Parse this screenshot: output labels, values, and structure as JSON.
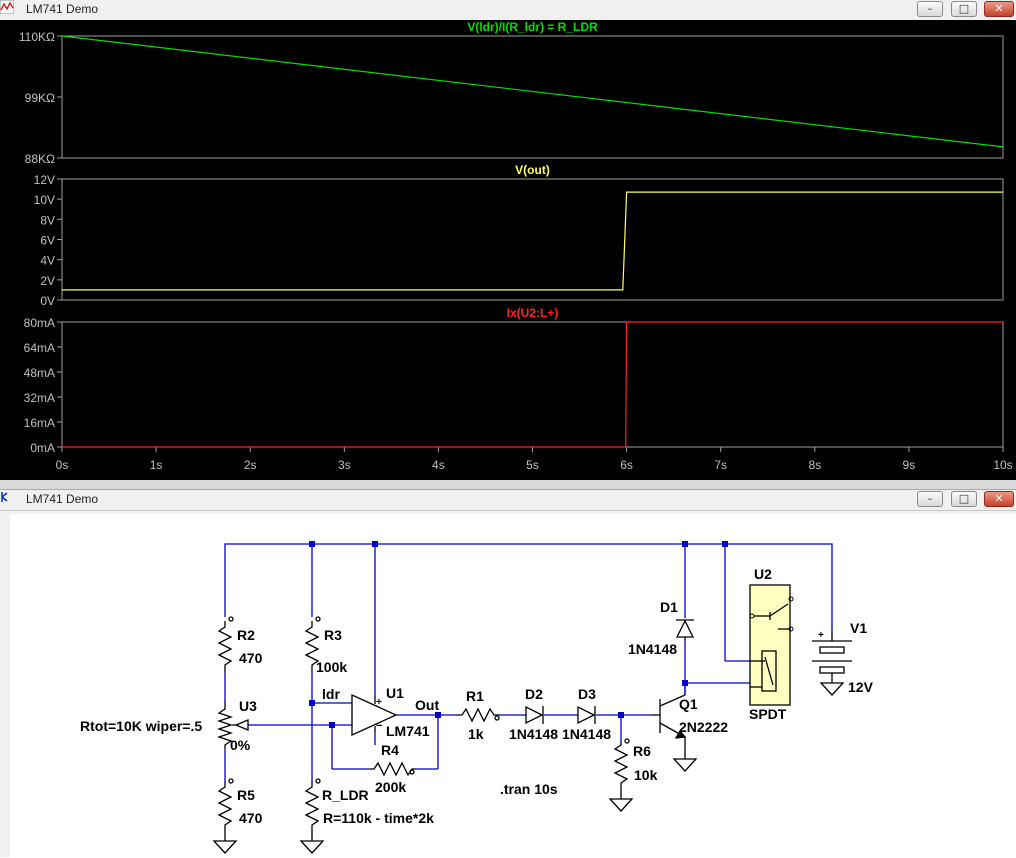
{
  "plot_window": {
    "title": "LM741 Demo",
    "buttons": {
      "minimize": "–",
      "maximize": "□",
      "close": "✕"
    }
  },
  "schematic_window": {
    "title": "LM741 Demo",
    "buttons": {
      "minimize": "–",
      "maximize": "□",
      "close": "✕"
    }
  },
  "colors": {
    "trace_rldr": "#00e000",
    "trace_vout": "#ffff60",
    "trace_current": "#ff2020",
    "plot_bg": "#000000",
    "plot_grid": "#a0a0a0",
    "plot_text": "#c0c0c0",
    "wire": "#0000cc",
    "component": "#000000"
  },
  "chart_data": [
    {
      "type": "line",
      "title": "V(ldr)/I(R_ldr) = R_LDR",
      "x": [
        0,
        10
      ],
      "series": [
        {
          "values": [
            110,
            90
          ]
        }
      ],
      "ylim": [
        88,
        110
      ],
      "yticks": [
        "110KΩ",
        "99KΩ",
        "88KΩ"
      ],
      "xlim": [
        0,
        10
      ]
    },
    {
      "type": "line",
      "title": "V(out)",
      "x": [
        0,
        5.96,
        6.0,
        10
      ],
      "series": [
        {
          "values": [
            1.0,
            1.0,
            10.7,
            10.7
          ]
        }
      ],
      "ylim": [
        0,
        12
      ],
      "yticks": [
        "12V",
        "10V",
        "8V",
        "6V",
        "4V",
        "2V",
        "0V"
      ],
      "xlim": [
        0,
        10
      ]
    },
    {
      "type": "line",
      "title": "Ix(U2:L+)",
      "x": [
        0,
        5.99,
        6.0,
        10
      ],
      "series": [
        {
          "values": [
            0,
            0,
            80,
            80
          ]
        }
      ],
      "ylim": [
        0,
        80
      ],
      "yticks": [
        "80mA",
        "64mA",
        "48mA",
        "32mA",
        "16mA",
        "0mA"
      ],
      "xlim": [
        0,
        10
      ],
      "xticks": [
        "0s",
        "1s",
        "2s",
        "3s",
        "4s",
        "5s",
        "6s",
        "7s",
        "8s",
        "9s",
        "10s"
      ]
    }
  ],
  "schematic": {
    "labels": {
      "r2_name": "R2",
      "r2_val": "470",
      "r3_name": "R3",
      "r3_val": "100k",
      "u3_name": "U3",
      "u3_param": "Rtot=10K wiper=.5",
      "u3_pct": "0%",
      "r5_name": "R5",
      "r5_val": "470",
      "ldr_net": "ldr",
      "rldr_name": "R_LDR",
      "rldr_val": "R=110k - time*2k",
      "u1_name": "U1",
      "u1_model": "LM741",
      "out_net": "Out",
      "r4_name": "R4",
      "r4_val": "200k",
      "r1_name": "R1",
      "r1_val": "1k",
      "d2_name": "D2",
      "d2_model": "1N4148",
      "d3_name": "D3",
      "d3_model": "1N4148",
      "d1_name": "D1",
      "d1_model": "1N4148",
      "r6_name": "R6",
      "r6_val": "10k",
      "q1_name": "Q1",
      "q1_model": "2N2222",
      "u2_name": "U2",
      "u2_model": "SPDT",
      "v1_name": "V1",
      "v1_val": "12V",
      "directive": ".tran 10s",
      "opamp_plus": "+",
      "opamp_minus": "−",
      "batt_plus": "+"
    }
  }
}
